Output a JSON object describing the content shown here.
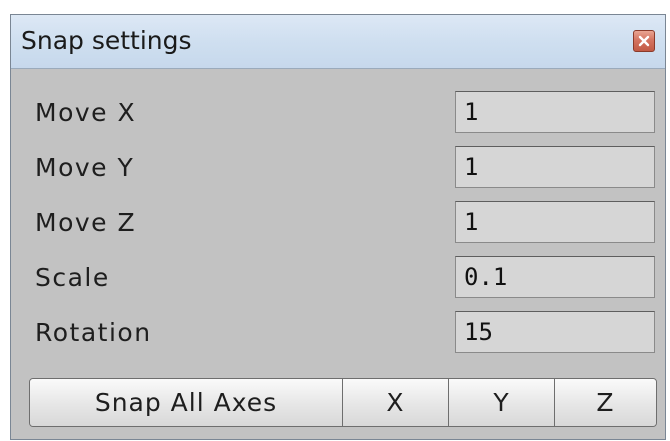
{
  "window": {
    "title": "Snap settings",
    "close_icon": "close-icon"
  },
  "fields": [
    {
      "label": "Move X",
      "value": "1"
    },
    {
      "label": "Move Y",
      "value": "1"
    },
    {
      "label": "Move Z",
      "value": "1"
    },
    {
      "label": "Scale",
      "value": "0.1"
    },
    {
      "label": "Rotation",
      "value": "15"
    }
  ],
  "buttons": {
    "snap_all": "Snap All Axes",
    "x": "X",
    "y": "Y",
    "z": "Z"
  },
  "colors": {
    "titlebar": "#cfdff0",
    "panel": "#c2c2c2",
    "field": "#d6d6d6",
    "close": "#d47461"
  }
}
